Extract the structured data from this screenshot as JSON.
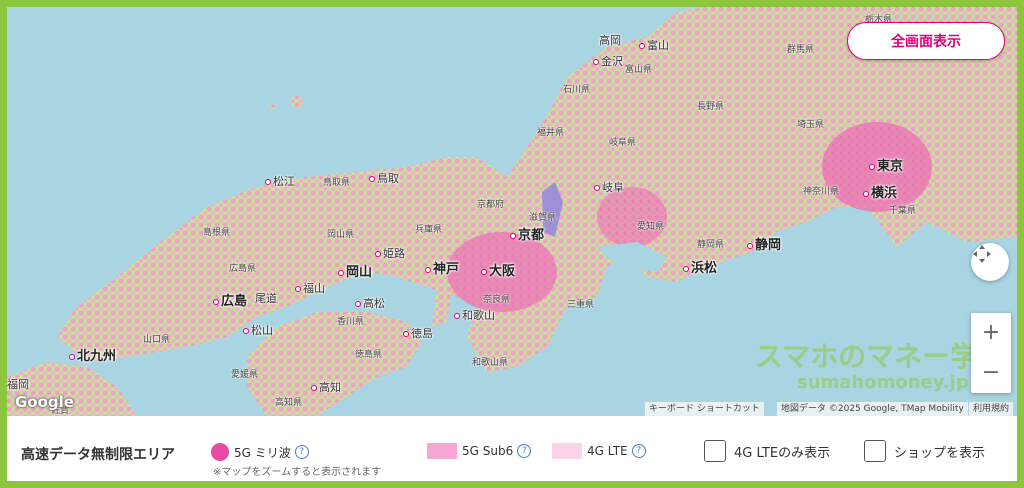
{
  "map": {
    "fullscreen_label": "全画面表示",
    "google_logo": "Google",
    "attribution": {
      "shortcuts": "キーボード ショートカット",
      "data": "地図データ ©2025 Google, TMap Mobility",
      "terms": "利用規約"
    },
    "watermark": {
      "line1": "スマホのマネー学",
      "line2": "sumahomoney.jp"
    },
    "controls": {
      "zoom_in": "+",
      "zoom_out": "−"
    },
    "cities": {
      "tokyo": "東京",
      "yokohama": "横浜",
      "shizuoka": "静岡",
      "hamamatsu": "浜松",
      "gifu": "岐阜",
      "kyoto": "京都",
      "osaka": "大阪",
      "kobe": "神戸",
      "himeji": "姫路",
      "okayama": "岡山",
      "hiroshima": "広島",
      "fukuyama": "福山",
      "onomichi": "尾道",
      "takamatsu": "高松",
      "tokushima": "徳島",
      "matsuyama": "松山",
      "kochi": "高知",
      "wakayama": "和歌山",
      "kitakyushu": "北九州",
      "matsue": "松江",
      "tottori": "鳥取",
      "kanazawa": "金沢",
      "toyama": "富山",
      "takaoka": "高岡",
      "fukuoka": "福岡"
    },
    "prefs": {
      "tochigi": "栃木県",
      "gunma": "群馬県",
      "nagano": "長野県",
      "saitama": "埼玉県",
      "kanagawa": "神奈川県",
      "chiba": "千葉県",
      "shizuoka": "静岡県",
      "aichi": "愛知県",
      "gifu": "岐阜県",
      "ishikawa": "石川県",
      "toyama": "富山県",
      "fukui": "福井県",
      "shiga": "滋賀県",
      "kyoto": "京都府",
      "mie": "三重県",
      "nara": "奈良県",
      "wakayama": "和歌山県",
      "hyogo": "兵庫県",
      "tottori": "鳥取県",
      "okayama": "岡山県",
      "shimane": "島根県",
      "hiroshima": "広島県",
      "yamaguchi": "山口県",
      "kagawa": "香川県",
      "tokushima": "徳島県",
      "ehime": "愛媛県",
      "kochi": "高知県",
      "saga": "佐賀"
    }
  },
  "legend": {
    "title": "高速データ無制限エリア",
    "items": [
      {
        "label": "5G ミリ波",
        "color": "#e84aa6"
      },
      {
        "label": "5G Sub6",
        "color": "#f7a6d2"
      },
      {
        "label": "4G LTE",
        "color": "#fbd3e8"
      }
    ],
    "note": "※マップをズームすると表示されます",
    "help_glyph": "?",
    "checkboxes": {
      "lte_only": "4G LTEのみ表示",
      "shops": "ショップを表示"
    }
  },
  "colors": {
    "accent": "#e0007a",
    "frame": "#8cc63f",
    "sea": "#a9d4e1",
    "land": "#b8d98a",
    "coverage": "#f08dc4"
  }
}
